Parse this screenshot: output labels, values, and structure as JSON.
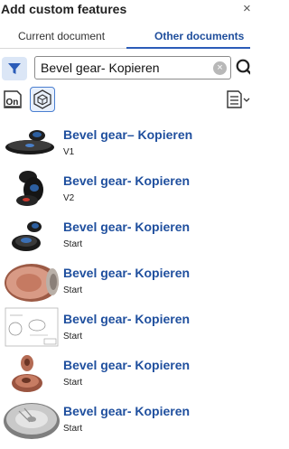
{
  "header": {
    "title": "Add custom features",
    "close": "×"
  },
  "tabs": [
    {
      "label": "Current document",
      "active": false
    },
    {
      "label": "Other documents",
      "active": true
    }
  ],
  "search": {
    "value": "Bevel gear- Kopieren",
    "clear": "×"
  },
  "toolbar": {
    "onshape_label": "On"
  },
  "items": [
    {
      "name": "Bevel gear– Kopieren",
      "version": "V1"
    },
    {
      "name": "Bevel gear- Kopieren",
      "version": "V2"
    },
    {
      "name": "Bevel gear- Kopieren",
      "version": "Start"
    },
    {
      "name": "Bevel gear- Kopieren",
      "version": "Start"
    },
    {
      "name": "Bevel gear- Kopieren",
      "version": "Start"
    },
    {
      "name": "Bevel gear- Kopieren",
      "version": "Start"
    },
    {
      "name": "Bevel gear- Kopieren",
      "version": "Start"
    }
  ],
  "colors": {
    "accent": "#2b5cb8",
    "link": "#1f4f9e",
    "filter_bg": "#dbe6f6"
  },
  "icons": [
    "filter-icon",
    "search-icon",
    "onshape-icon",
    "assembly-icon",
    "list-view-icon",
    "close-icon",
    "clear-icon"
  ]
}
